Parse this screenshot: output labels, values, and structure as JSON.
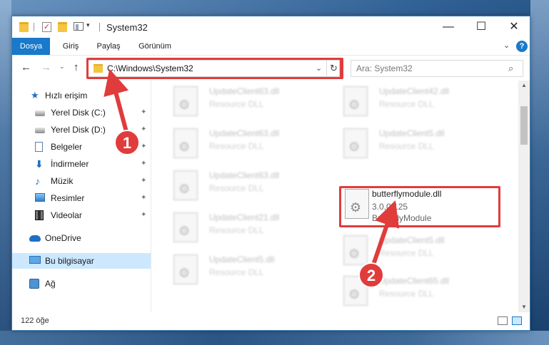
{
  "window": {
    "title": "System32",
    "minimize_glyph": "—",
    "maximize_glyph": "☐",
    "close_glyph": "✕"
  },
  "ribbon": {
    "tabs": [
      "Dosya",
      "Giriş",
      "Paylaş",
      "Görünüm"
    ],
    "expand_glyph": "⌄",
    "help_glyph": "?"
  },
  "nav": {
    "back_glyph": "←",
    "forward_glyph": "→",
    "recent_glyph": "⌄",
    "up_glyph": "↑",
    "address_path": "C:\\Windows\\System32",
    "address_dropdown_glyph": "⌄",
    "refresh_glyph": "↻",
    "search_placeholder": "Ara: System32",
    "search_glyph": "⌕"
  },
  "sidebar": {
    "items": [
      {
        "label": "Hızlı erişim",
        "icon": "quick-access-icon",
        "pinned": false
      },
      {
        "label": "Yerel Disk (C:)",
        "icon": "drive-icon",
        "pinned": true
      },
      {
        "label": "Yerel Disk (D:)",
        "icon": "drive-icon",
        "pinned": true
      },
      {
        "label": "Belgeler",
        "icon": "documents-icon",
        "pinned": true
      },
      {
        "label": "İndirmeler",
        "icon": "downloads-icon",
        "pinned": true
      },
      {
        "label": "Müzik",
        "icon": "music-icon",
        "pinned": true
      },
      {
        "label": "Resimler",
        "icon": "pictures-icon",
        "pinned": true
      },
      {
        "label": "Videolar",
        "icon": "videos-icon",
        "pinned": true
      },
      {
        "label": "OneDrive",
        "icon": "onedrive-icon",
        "pinned": false
      },
      {
        "label": "Bu bilgisayar",
        "icon": "this-pc-icon",
        "pinned": false,
        "selected": true
      },
      {
        "label": "Ağ",
        "icon": "network-icon",
        "pinned": false
      }
    ],
    "pin_glyph": "📌"
  },
  "files": [
    {
      "name": "UpdateClient63.dll",
      "type": "Resource DLL"
    },
    {
      "name": "UpdateClient42.dll",
      "type": "Resource DLL"
    },
    {
      "name": "UpdateClient63.dll",
      "type": "Resource DLL"
    },
    {
      "name": "UpdateClient5.dll",
      "type": "Resource DLL"
    },
    {
      "name": "UpdateClient63.dll",
      "type": "Resource DLL"
    },
    {
      "name": "butterflymodule.dll",
      "version": "3.0.0.125",
      "type": "ButterflyModule",
      "highlighted": true
    },
    {
      "name": "UpdateClient21.dll",
      "type": "Resource DLL"
    },
    {
      "name": "UpdateClient5.dll",
      "type": "Resource DLL"
    },
    {
      "name": "UpdateClient5.dll",
      "type": "Resource DLL"
    },
    {
      "name": "UpdateClient65.dll",
      "type": "Resource DLL"
    }
  ],
  "status": {
    "item_count": "122 öğe"
  },
  "annotations": {
    "step1": "1",
    "step2": "2",
    "color": "#e03c3c"
  }
}
